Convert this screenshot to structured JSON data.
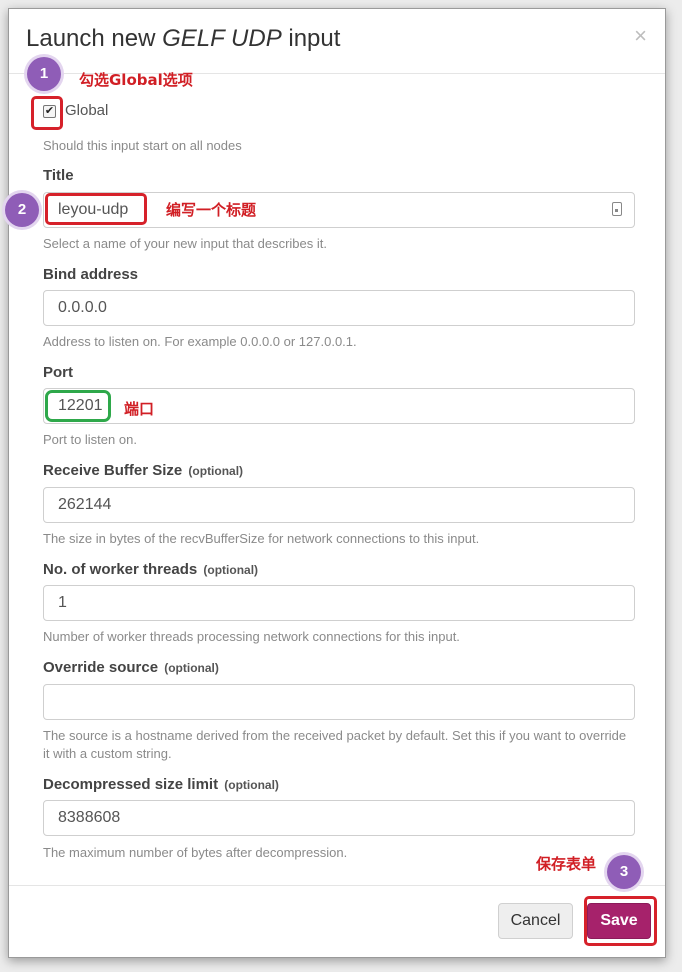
{
  "modal": {
    "title_prefix": "Launch new ",
    "title_type": "GELF UDP",
    "title_suffix": " input",
    "close_glyph": "×"
  },
  "global": {
    "checked": true,
    "check_glyph": "✔",
    "label": "Global",
    "help": "Should this input start on all nodes"
  },
  "fields": {
    "title": {
      "label": "Title",
      "value": "leyou-udp",
      "help": "Select a name of your new input that describes it."
    },
    "bind_address": {
      "label": "Bind address",
      "value": "0.0.0.0",
      "help": "Address to listen on. For example 0.0.0.0 or 127.0.0.1."
    },
    "port": {
      "label": "Port",
      "value": "12201",
      "help": "Port to listen on."
    },
    "receive_buffer_size": {
      "label": "Receive Buffer Size",
      "optional": "(optional)",
      "value": "262144",
      "help": "The size in bytes of the recvBufferSize for network connections to this input."
    },
    "worker_threads": {
      "label": "No. of worker threads",
      "optional": "(optional)",
      "value": "1",
      "help": "Number of worker threads processing network connections for this input."
    },
    "override_source": {
      "label": "Override source",
      "optional": "(optional)",
      "value": "",
      "help": "The source is a hostname derived from the received packet by default. Set this if you want to override it with a custom string."
    },
    "decompressed_size_limit": {
      "label": "Decompressed size limit",
      "optional": "(optional)",
      "value": "8388608",
      "help": "The maximum number of bytes after decompression."
    }
  },
  "footer": {
    "cancel_label": "Cancel",
    "save_label": "Save"
  },
  "annotations": {
    "badge1": "1",
    "note1": "勾选Global选项",
    "badge2": "2",
    "note2": "编写一个标题",
    "note_port": "端口",
    "badge3": "3",
    "note3": "保存表单"
  },
  "colors": {
    "primary": "#a6226b",
    "annotation_red": "#d6212a",
    "annotation_green": "#2ea84a",
    "badge_purple": "#8f5db7"
  }
}
